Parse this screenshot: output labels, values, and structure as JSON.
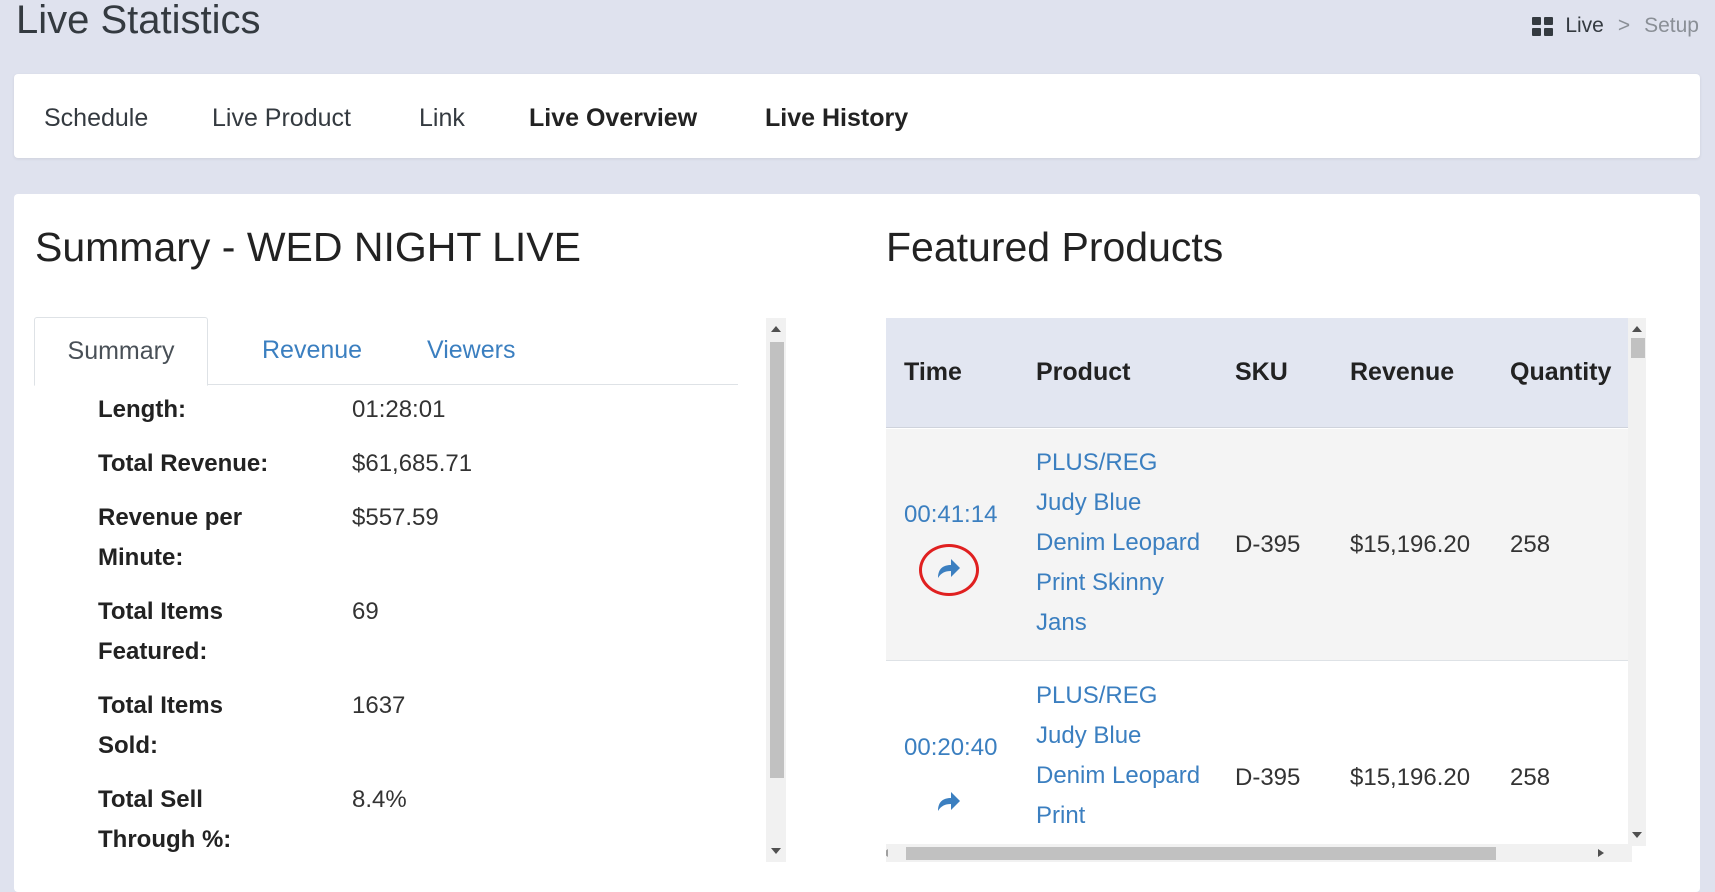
{
  "page_title": "Live Statistics",
  "breadcrumb": {
    "icon": "dashboard-grid-icon",
    "current": "Live",
    "separator": ">",
    "next": "Setup"
  },
  "nav": {
    "items": [
      {
        "label": "Schedule"
      },
      {
        "label": "Live Product"
      },
      {
        "label": "Link"
      },
      {
        "label": "Live Overview"
      },
      {
        "label": "Live History"
      }
    ]
  },
  "summary": {
    "title": "Summary - WED NIGHT LIVE",
    "tabs": [
      "Summary",
      "Revenue",
      "Viewers"
    ],
    "rows": [
      {
        "label": "Length:",
        "value": "01:28:01"
      },
      {
        "label": "Total Revenue:",
        "value": "$61,685.71"
      },
      {
        "label": "Revenue per Minute:",
        "value": "$557.59"
      },
      {
        "label": "Total Items Featured:",
        "value": "69"
      },
      {
        "label": "Total Items Sold:",
        "value": "1637"
      },
      {
        "label": "Total Sell Through %:",
        "value": "8.4%"
      }
    ]
  },
  "featured": {
    "title": "Featured Products",
    "columns": [
      "Time",
      "Product",
      "SKU",
      "Revenue",
      "Quantity"
    ],
    "rows": [
      {
        "time": "00:41:14",
        "product": "PLUS/REG Judy Blue Denim Leopard Print Skinny Jans",
        "sku": "D-395",
        "revenue": "$15,196.20",
        "quantity": "258",
        "action_icon": "share-arrow-icon"
      },
      {
        "time": "00:20:40",
        "product": "PLUS/REG Judy Blue Denim Leopard Print",
        "sku": "D-395",
        "revenue": "$15,196.20",
        "quantity": "258",
        "action_icon": "share-arrow-icon"
      }
    ]
  },
  "colors": {
    "accent_link": "#3b7fc0",
    "highlight_circle": "#e02020",
    "table_header_bg": "#e2e6f1",
    "page_bg": "#dfe2ee"
  }
}
